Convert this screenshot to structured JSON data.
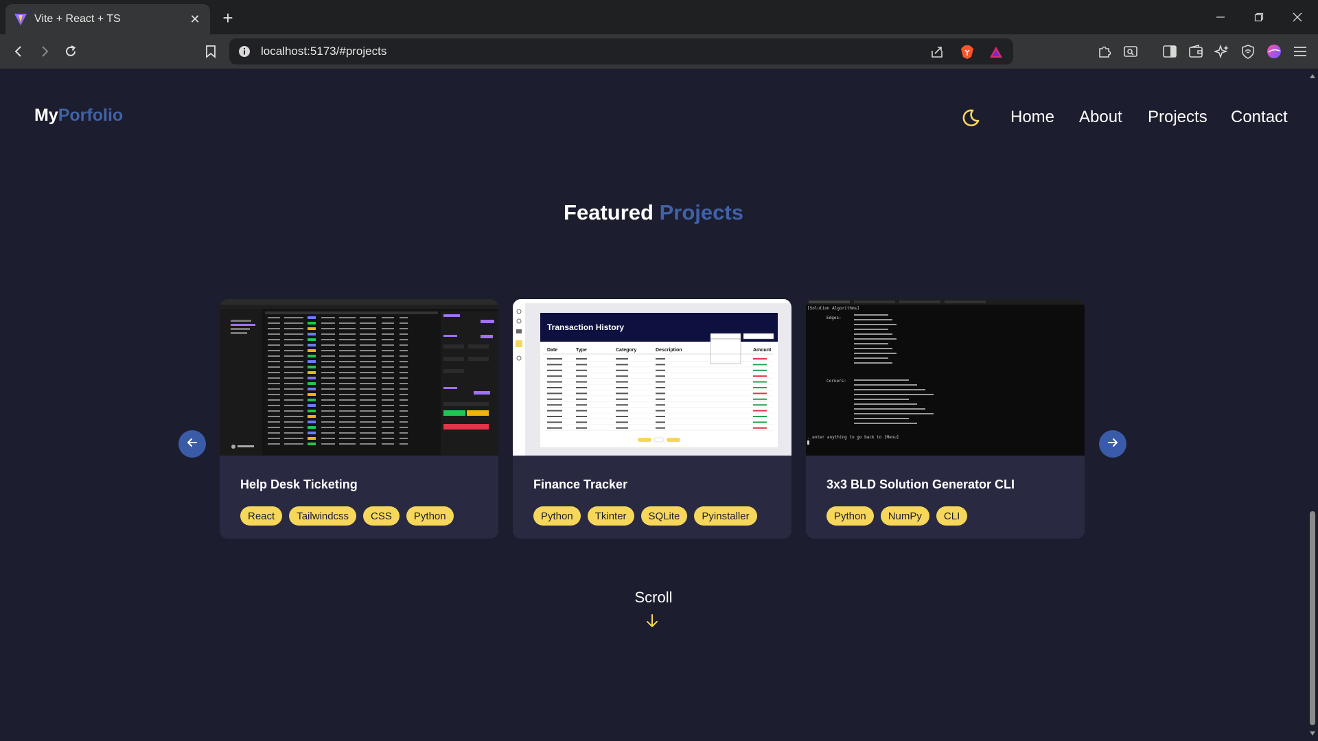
{
  "browser": {
    "tab_title": "Vite + React + TS",
    "url": "localhost:5173/#projects"
  },
  "header": {
    "logo_part1": "My",
    "logo_part2": "Porfolio",
    "nav": [
      "Home",
      "About",
      "Projects",
      "Contact"
    ]
  },
  "section": {
    "title_part1": "Featured",
    "title_part2": "Projects"
  },
  "projects": [
    {
      "title": "Help Desk Ticketing",
      "tags": [
        "React",
        "Tailwindcss",
        "CSS",
        "Python"
      ]
    },
    {
      "title": "Finance Tracker",
      "tags": [
        "Python",
        "Tkinter",
        "SQLite",
        "Pyinstaller"
      ]
    },
    {
      "title": "3x3 BLD Solution Generator CLI",
      "tags": [
        "Python",
        "NumPy",
        "CLI"
      ]
    }
  ],
  "thumb_finance": {
    "heading": "Transaction History",
    "columns": [
      "Date",
      "Type",
      "Category",
      "Description",
      "Amount"
    ]
  },
  "thumb_terminal": {
    "header": "[Solution Algorithms]",
    "edges_label": "Edges:",
    "corners_label": "Corners:",
    "prompt": "..enter anything to go back to [Menu]"
  },
  "scroll_hint": "Scroll",
  "colors": {
    "background": "#1c1d2e",
    "card": "#292a42",
    "accent": "#3f62a8",
    "tag": "#f6d75a",
    "button": "#3a5ba8"
  }
}
